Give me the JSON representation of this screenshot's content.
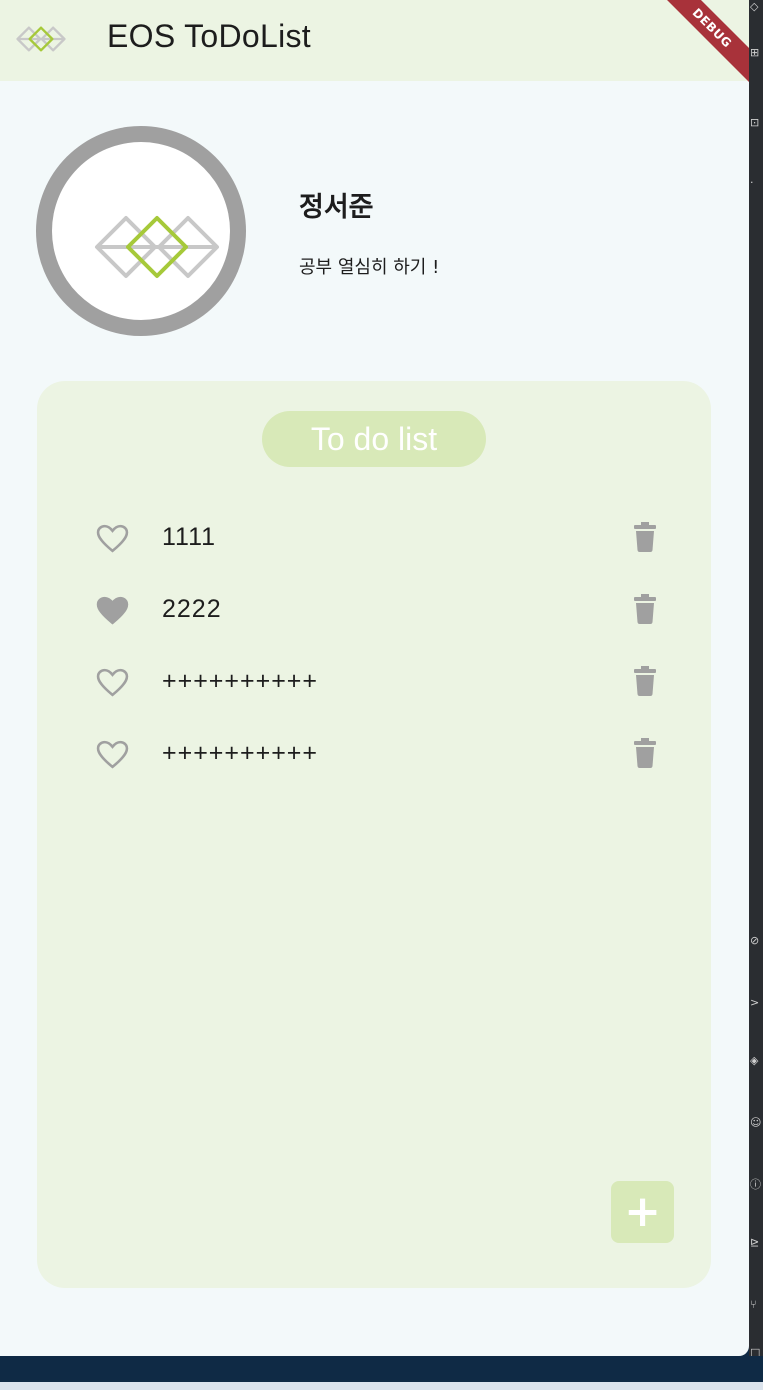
{
  "app": {
    "title": "EOS ToDoList",
    "debug_banner": "DEBUG"
  },
  "profile": {
    "name": "정서준",
    "status": "공부 열심히 하기 !"
  },
  "todo": {
    "title": "To do list",
    "items": [
      {
        "text": "1111",
        "liked": false
      },
      {
        "text": "2222",
        "liked": true
      },
      {
        "text": "++++++++++",
        "liked": false
      },
      {
        "text": "++++++++++",
        "liked": false
      }
    ],
    "add_label": "+"
  },
  "icons": {
    "logo": "eos-logo-icon",
    "heart_outline": "heart-outline-icon",
    "heart_filled": "heart-filled-icon",
    "delete": "trash-icon",
    "add": "plus-icon"
  },
  "colors": {
    "appbar_bg": "#ecf4e3",
    "page_bg": "#f3f9fa",
    "card_bg": "#ecf4e3",
    "accent": "#d8e9b8",
    "logo_green": "#a6c93a",
    "icon_gray": "#a0a0a0",
    "debug_red": "#a8323a"
  }
}
